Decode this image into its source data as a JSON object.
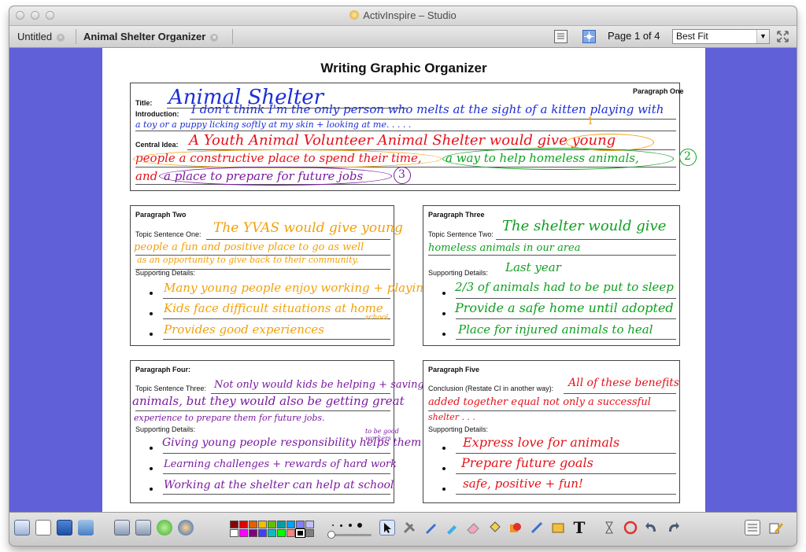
{
  "window": {
    "title": "ActivInspire – Studio"
  },
  "tabs": [
    {
      "label": "Untitled"
    },
    {
      "label": "Animal Shelter Organizer"
    }
  ],
  "toolbar_top": {
    "page_indicator": "Page 1 of 4",
    "zoom": {
      "selected": "Best Fit"
    }
  },
  "document": {
    "title": "Writing Graphic Organizer",
    "paragraph_one": {
      "heading": "Paragraph One",
      "title_label": "Title:",
      "title_hw": "Animal Shelter",
      "intro_label": "Introduction:",
      "intro_hw_1": "I don't think I'm the only person who melts at the sight of a kitten playing with",
      "intro_hw_2": "a toy or a puppy licking softly at my skin + looking at me. . . . .",
      "central_label": "Central Idea:",
      "central_hw_1": "A Youth Animal Volunteer Animal Shelter would give young",
      "central_hw_2a": "people a constructive place to spend their time,",
      "central_hw_2b": "a way to help homeless animals,",
      "central_hw_3a": "and",
      "central_hw_3b": "a place to prepare for future jobs",
      "num_1": "1",
      "num_2": "2",
      "num_3": "3"
    },
    "paragraph_two": {
      "heading": "Paragraph Two",
      "topic_label": "Topic Sentence One:",
      "topic_hw_1": "The YVAS would give young",
      "topic_hw_2": "people a fun and positive place to go as well",
      "topic_hw_3": "as an opportunity to give back to their community.",
      "details_label": "Supporting Details:",
      "details": [
        "Many young people enjoy working + playing",
        "Kids face difficult situations at home",
        "Provides good experiences"
      ],
      "extra": "school"
    },
    "paragraph_three": {
      "heading": "Paragraph Three",
      "topic_label": "Topic Sentence Two:",
      "topic_hw_1": "The shelter would give",
      "topic_hw_2": "homeless animals in our area",
      "details_label": "Supporting Details:",
      "details_note": "Last year",
      "details": [
        "2/3 of animals had to be put to sleep",
        "Provide a safe home until adopted",
        "Place for injured animals to heal"
      ]
    },
    "paragraph_four": {
      "heading": "Paragraph Four:",
      "topic_label": "Topic Sentence Three:",
      "topic_hw_1": "Not only would kids be helping + saving",
      "topic_hw_2": "animals, but they would also be getting great",
      "topic_hw_3": "experience to prepare them for future jobs.",
      "details_label": "Supporting Details:",
      "details": [
        "Giving young people responsibility helps them",
        "Learning challenges + rewards of hard work",
        "Working at the shelter can help at school"
      ],
      "extra": "to be good workers"
    },
    "paragraph_five": {
      "heading": "Paragraph Five",
      "conclusion_label": "Conclusion (Restate CI in another way):",
      "conclusion_hw_1": "All of these benefits",
      "conclusion_hw_2": "added together equal not only a successful",
      "conclusion_hw_3": "shelter . . .",
      "details_label": "Supporting Details:",
      "details": [
        "Express love for animals",
        "Prepare future goals",
        "safe, positive + fun!"
      ]
    }
  },
  "colors": {
    "canvas": "#6060d8",
    "ink_blue": "#1a2ed6",
    "ink_red": "#e4121a",
    "ink_orange": "#f2a10a",
    "ink_green": "#10a020",
    "ink_purple": "#7a1aa0"
  },
  "palette": [
    "#8b0000",
    "#e00000",
    "#e06000",
    "#f0c000",
    "#60c000",
    "#00a0a0",
    "#00a0ff",
    "#8080ff",
    "#c0c0ff",
    "#ffffff",
    "#ff00ff",
    "#800080",
    "#4040ff",
    "#00c0c0",
    "#00ff00",
    "#ff8080",
    "#000000",
    "#808080"
  ]
}
